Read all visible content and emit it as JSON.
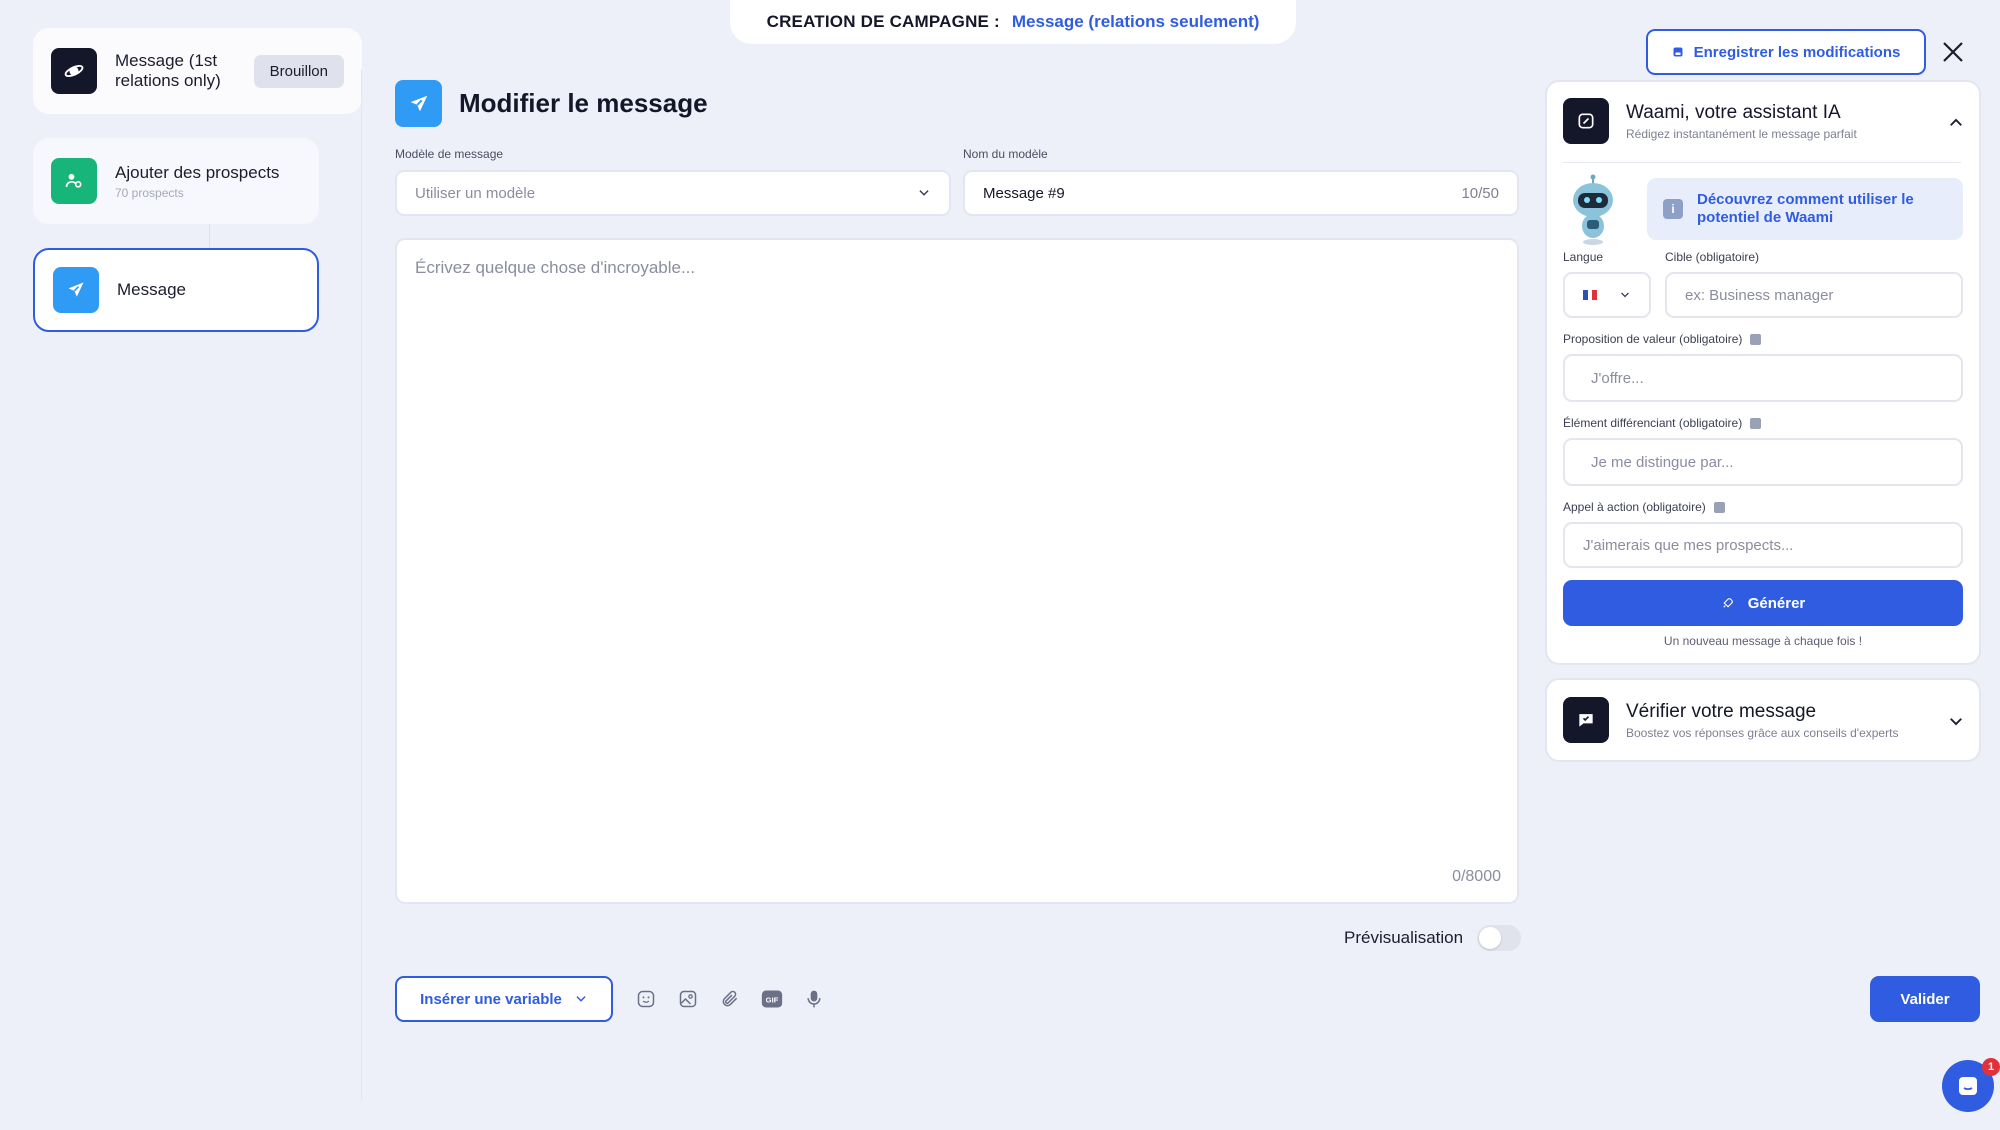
{
  "banner": {
    "label": "CREATION DE CAMPAGNE :",
    "value": "Message (relations seulement)"
  },
  "steps": [
    {
      "title": "Message (1st relations only)",
      "badge": "Brouillon",
      "icon": "planet-icon",
      "color": "#14162a"
    },
    {
      "title": "Ajouter des prospects",
      "subtitle": "70 prospects",
      "icon": "user-location-icon",
      "color": "#17b57a"
    },
    {
      "title": "Message",
      "icon": "send-icon",
      "color": "#2f9bf5",
      "active": true
    }
  ],
  "editor": {
    "title": "Modifier le message",
    "template_label": "Modèle de message",
    "template_placeholder": "Utiliser un modèle",
    "name_label": "Nom du modèle",
    "name_value": "Message #9",
    "name_count": "10/50",
    "body_placeholder": "Écrivez quelque chose d'incroyable...",
    "body_count": "0/8000",
    "preview_label": "Prévisualisation",
    "preview_on": false,
    "insert_variable": "Insérer une variable",
    "tools": [
      "emoji-icon",
      "image-icon",
      "attachment-icon",
      "gif-icon",
      "microphone-icon"
    ],
    "gif_text": "GIF",
    "validate": "Valider"
  },
  "header_actions": {
    "save": "Enregistrer les modifications"
  },
  "ai": {
    "title": "Waami, votre assistant IA",
    "subtitle": "Rédigez instantanément le message parfait",
    "tip": "Découvrez comment utiliser le potentiel de Waami",
    "language_label": "Langue",
    "language_value": "FR",
    "target_label": "Cible (obligatoire)",
    "target_placeholder": "ex: Business manager",
    "value_prop_label": "Proposition de valeur (obligatoire)",
    "value_prop_placeholder": "J'offre...",
    "differentiator_label": "Élément différenciant (obligatoire)",
    "differentiator_placeholder": "Je me distingue par...",
    "cta_label": "Appel à action (obligatoire)",
    "cta_placeholder": "J'aimerais que mes prospects...",
    "generate": "Générer",
    "generate_note": "Un nouveau message à chaque fois !"
  },
  "verify": {
    "title": "Vérifier votre message",
    "subtitle": "Boostez vos réponses grâce aux conseils d'experts"
  },
  "chat": {
    "notifications": "1"
  },
  "colors": {
    "accent": "#2f5ce0",
    "background": "#eef0f9",
    "message_icon": "#2f9bf5",
    "prospects_icon": "#17b57a",
    "dark_icon": "#14162a",
    "notification": "#e0323b"
  }
}
